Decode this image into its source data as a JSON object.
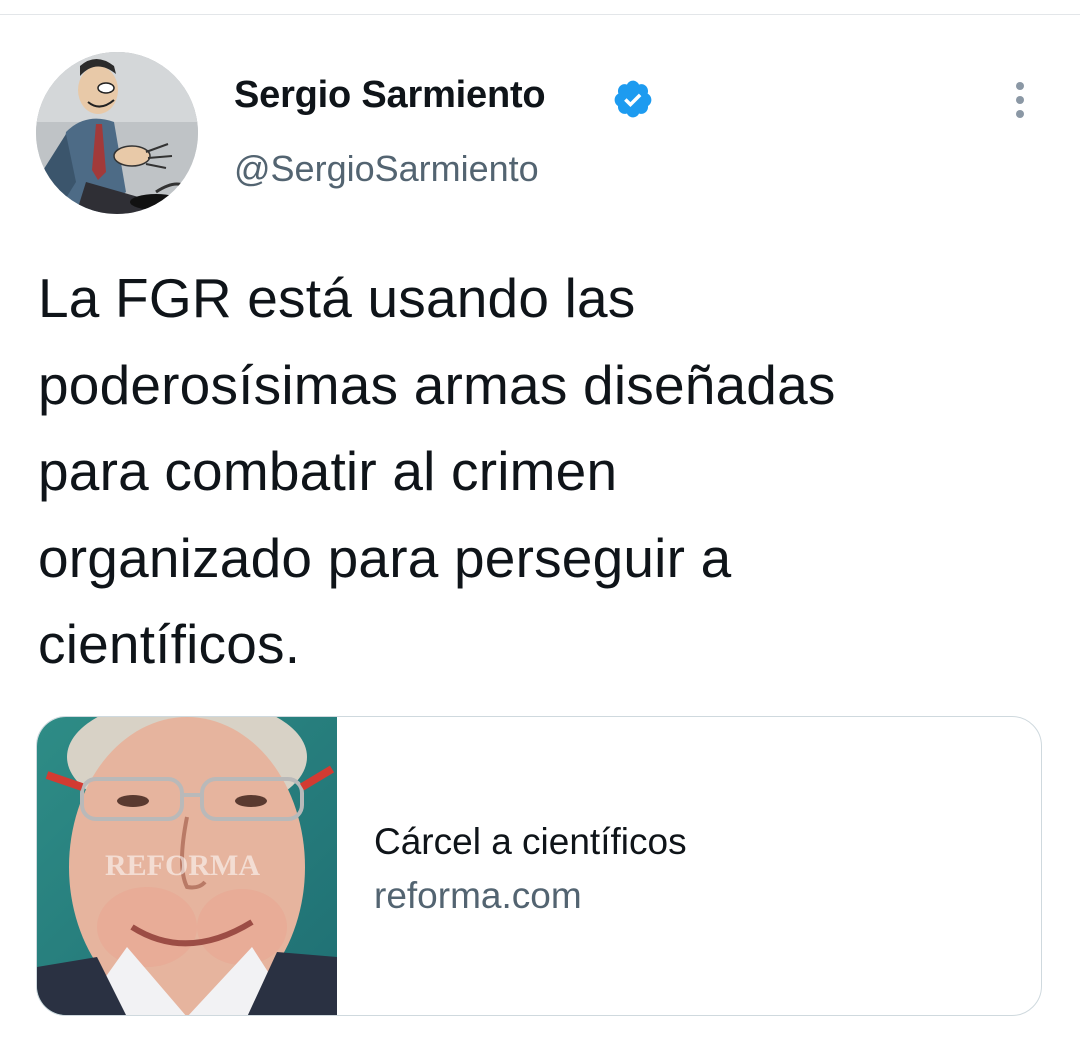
{
  "author": {
    "display_name": "Sergio Sarmiento",
    "handle": "@SergioSarmiento",
    "verified": true
  },
  "tweet": {
    "text_lines": [
      "La FGR está usando las",
      "poderosísimas armas diseñadas",
      "para combatir al crimen",
      "organizado para perseguir a",
      "científicos."
    ]
  },
  "link_card": {
    "title": "Cárcel a científicos",
    "domain": "reforma.com",
    "thumbnail_watermark": "REFORMA"
  },
  "icons": {
    "verified": "verified-badge-icon",
    "more": "more-vertical-icon"
  },
  "colors": {
    "text_primary": "#0f1419",
    "text_secondary": "#536471",
    "verified_blue": "#1d9bf0",
    "card_border": "#cfd9de"
  }
}
